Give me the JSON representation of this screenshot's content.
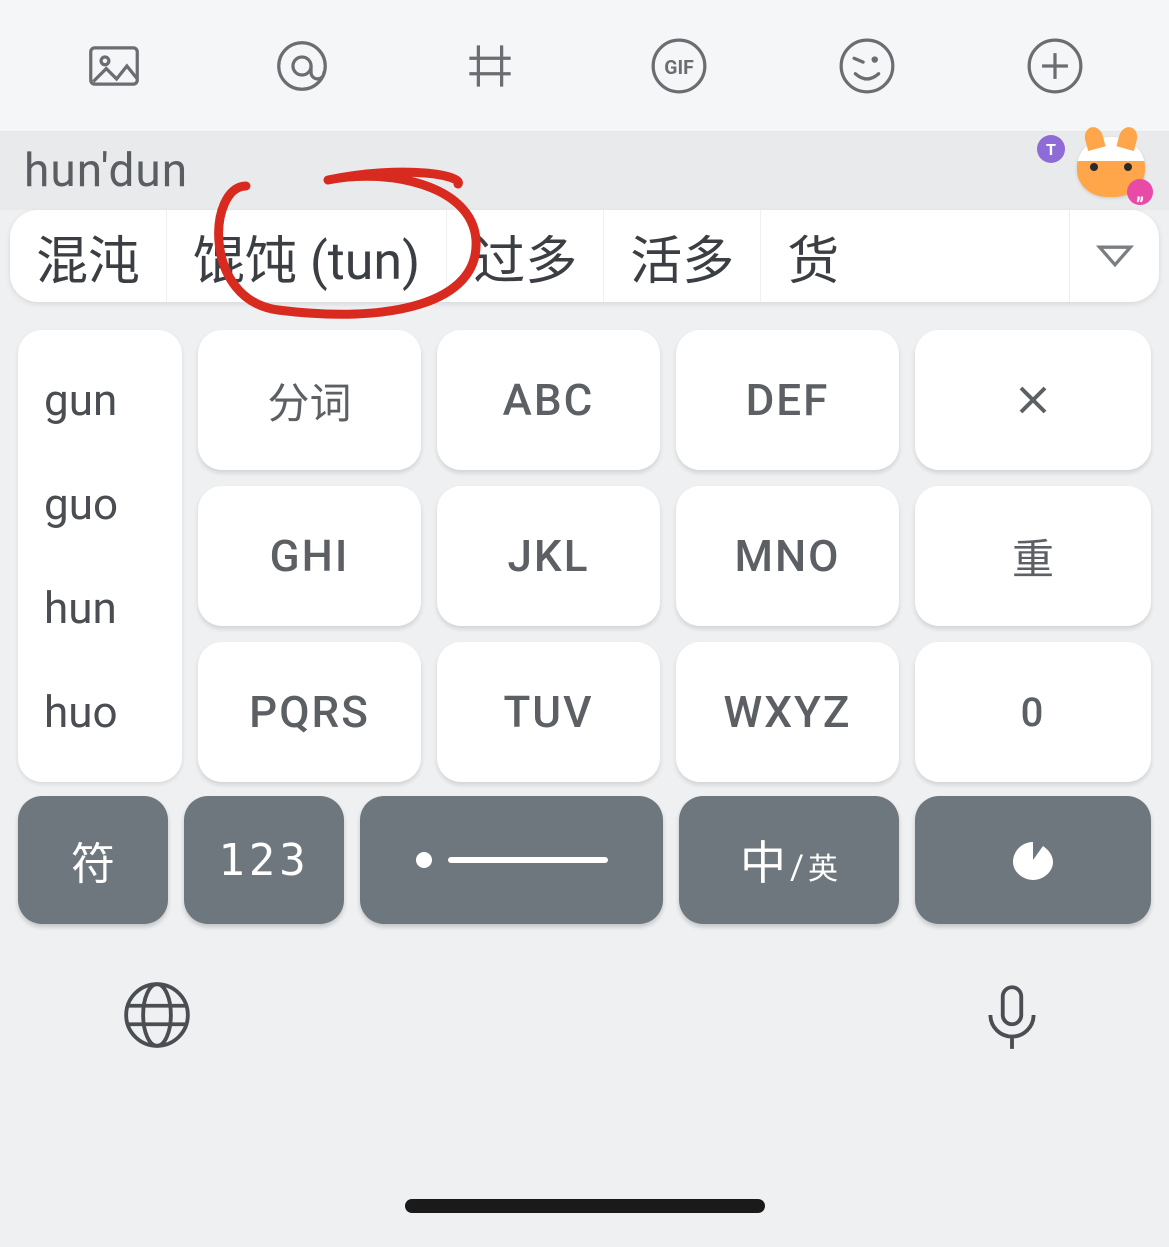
{
  "toolbar": {
    "icons": [
      "image-icon",
      "at-icon",
      "hash-icon",
      "gif-icon",
      "emoji-icon",
      "plus-icon"
    ]
  },
  "pinyin": "hun'dun",
  "mascot": {
    "badge_left": "T",
    "badge_right": "„"
  },
  "candidates": [
    "混沌",
    "馄饨 (tun)",
    "过多",
    "活多",
    "货"
  ],
  "expand_icon": "chevron-down",
  "side_options": [
    "gun",
    "guo",
    "hun",
    "huo"
  ],
  "keys": {
    "r1c1": "分词",
    "r1c2": "ABC",
    "r1c3": "DEF",
    "r1c4": "×",
    "r2c1": "GHI",
    "r2c2": "JKL",
    "r2c3": "MNO",
    "r2c4": "重",
    "r3c1": "PQRS",
    "r3c2": "TUV",
    "r3c3": "WXYZ",
    "r3c4": "0"
  },
  "dark": {
    "sym": "符",
    "num": "123",
    "lang_big": "中",
    "lang_sep": "/",
    "lang_small": "英"
  }
}
